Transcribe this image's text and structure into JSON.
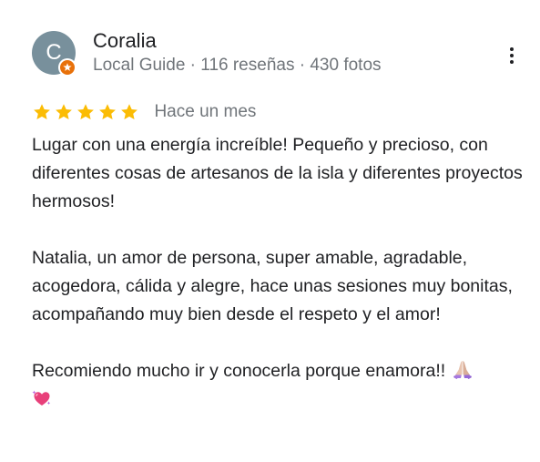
{
  "reviewer": {
    "avatar_initial": "C",
    "avatar_color": "#78909c",
    "badge_icon": "local-guide-star-icon",
    "badge_color": "#e8710a",
    "name": "Coralia",
    "meta": "Local Guide · 116 reseñas · 430 fotos"
  },
  "review": {
    "rating": 5,
    "max_rating": 5,
    "star_color": "#fbbc04",
    "date": "Hace un mes",
    "paragraph_1": "Lugar con una energía increíble! Pequeño y precioso, con diferentes cosas de artesanos de la isla y diferentes proyectos hermosos!",
    "paragraph_2": "Natalia, un amor de persona, super amable, agradable, acogedora, cálida y alegre, hace unas sesiones muy bonitas, acompañando muy bien desde el respeto y el amor!",
    "paragraph_3": "Recomiendo mucho ir y conocerla porque enamora!!",
    "emojis": [
      "folded-hands-emoji",
      "sparkling-heart-emoji"
    ]
  },
  "actions": {
    "more_icon": "more-vert-icon"
  }
}
